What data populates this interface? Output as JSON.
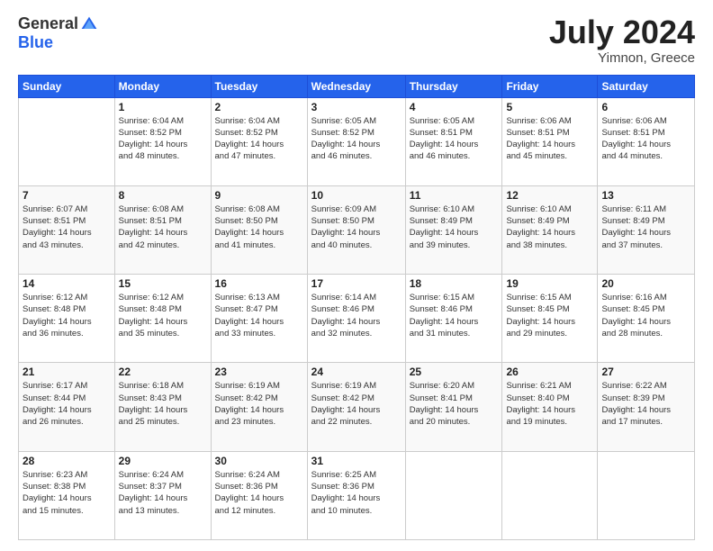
{
  "logo": {
    "general": "General",
    "blue": "Blue"
  },
  "title": "July 2024",
  "location": "Yimnon, Greece",
  "days_header": [
    "Sunday",
    "Monday",
    "Tuesday",
    "Wednesday",
    "Thursday",
    "Friday",
    "Saturday"
  ],
  "weeks": [
    [
      {
        "day": "",
        "info": ""
      },
      {
        "day": "1",
        "info": "Sunrise: 6:04 AM\nSunset: 8:52 PM\nDaylight: 14 hours\nand 48 minutes."
      },
      {
        "day": "2",
        "info": "Sunrise: 6:04 AM\nSunset: 8:52 PM\nDaylight: 14 hours\nand 47 minutes."
      },
      {
        "day": "3",
        "info": "Sunrise: 6:05 AM\nSunset: 8:52 PM\nDaylight: 14 hours\nand 46 minutes."
      },
      {
        "day": "4",
        "info": "Sunrise: 6:05 AM\nSunset: 8:51 PM\nDaylight: 14 hours\nand 46 minutes."
      },
      {
        "day": "5",
        "info": "Sunrise: 6:06 AM\nSunset: 8:51 PM\nDaylight: 14 hours\nand 45 minutes."
      },
      {
        "day": "6",
        "info": "Sunrise: 6:06 AM\nSunset: 8:51 PM\nDaylight: 14 hours\nand 44 minutes."
      }
    ],
    [
      {
        "day": "7",
        "info": "Sunrise: 6:07 AM\nSunset: 8:51 PM\nDaylight: 14 hours\nand 43 minutes."
      },
      {
        "day": "8",
        "info": "Sunrise: 6:08 AM\nSunset: 8:51 PM\nDaylight: 14 hours\nand 42 minutes."
      },
      {
        "day": "9",
        "info": "Sunrise: 6:08 AM\nSunset: 8:50 PM\nDaylight: 14 hours\nand 41 minutes."
      },
      {
        "day": "10",
        "info": "Sunrise: 6:09 AM\nSunset: 8:50 PM\nDaylight: 14 hours\nand 40 minutes."
      },
      {
        "day": "11",
        "info": "Sunrise: 6:10 AM\nSunset: 8:49 PM\nDaylight: 14 hours\nand 39 minutes."
      },
      {
        "day": "12",
        "info": "Sunrise: 6:10 AM\nSunset: 8:49 PM\nDaylight: 14 hours\nand 38 minutes."
      },
      {
        "day": "13",
        "info": "Sunrise: 6:11 AM\nSunset: 8:49 PM\nDaylight: 14 hours\nand 37 minutes."
      }
    ],
    [
      {
        "day": "14",
        "info": "Sunrise: 6:12 AM\nSunset: 8:48 PM\nDaylight: 14 hours\nand 36 minutes."
      },
      {
        "day": "15",
        "info": "Sunrise: 6:12 AM\nSunset: 8:48 PM\nDaylight: 14 hours\nand 35 minutes."
      },
      {
        "day": "16",
        "info": "Sunrise: 6:13 AM\nSunset: 8:47 PM\nDaylight: 14 hours\nand 33 minutes."
      },
      {
        "day": "17",
        "info": "Sunrise: 6:14 AM\nSunset: 8:46 PM\nDaylight: 14 hours\nand 32 minutes."
      },
      {
        "day": "18",
        "info": "Sunrise: 6:15 AM\nSunset: 8:46 PM\nDaylight: 14 hours\nand 31 minutes."
      },
      {
        "day": "19",
        "info": "Sunrise: 6:15 AM\nSunset: 8:45 PM\nDaylight: 14 hours\nand 29 minutes."
      },
      {
        "day": "20",
        "info": "Sunrise: 6:16 AM\nSunset: 8:45 PM\nDaylight: 14 hours\nand 28 minutes."
      }
    ],
    [
      {
        "day": "21",
        "info": "Sunrise: 6:17 AM\nSunset: 8:44 PM\nDaylight: 14 hours\nand 26 minutes."
      },
      {
        "day": "22",
        "info": "Sunrise: 6:18 AM\nSunset: 8:43 PM\nDaylight: 14 hours\nand 25 minutes."
      },
      {
        "day": "23",
        "info": "Sunrise: 6:19 AM\nSunset: 8:42 PM\nDaylight: 14 hours\nand 23 minutes."
      },
      {
        "day": "24",
        "info": "Sunrise: 6:19 AM\nSunset: 8:42 PM\nDaylight: 14 hours\nand 22 minutes."
      },
      {
        "day": "25",
        "info": "Sunrise: 6:20 AM\nSunset: 8:41 PM\nDaylight: 14 hours\nand 20 minutes."
      },
      {
        "day": "26",
        "info": "Sunrise: 6:21 AM\nSunset: 8:40 PM\nDaylight: 14 hours\nand 19 minutes."
      },
      {
        "day": "27",
        "info": "Sunrise: 6:22 AM\nSunset: 8:39 PM\nDaylight: 14 hours\nand 17 minutes."
      }
    ],
    [
      {
        "day": "28",
        "info": "Sunrise: 6:23 AM\nSunset: 8:38 PM\nDaylight: 14 hours\nand 15 minutes."
      },
      {
        "day": "29",
        "info": "Sunrise: 6:24 AM\nSunset: 8:37 PM\nDaylight: 14 hours\nand 13 minutes."
      },
      {
        "day": "30",
        "info": "Sunrise: 6:24 AM\nSunset: 8:36 PM\nDaylight: 14 hours\nand 12 minutes."
      },
      {
        "day": "31",
        "info": "Sunrise: 6:25 AM\nSunset: 8:36 PM\nDaylight: 14 hours\nand 10 minutes."
      },
      {
        "day": "",
        "info": ""
      },
      {
        "day": "",
        "info": ""
      },
      {
        "day": "",
        "info": ""
      }
    ]
  ]
}
